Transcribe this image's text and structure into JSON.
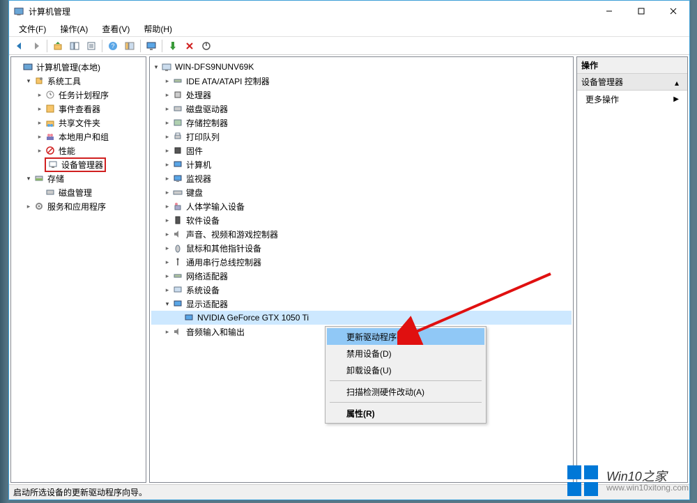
{
  "window": {
    "title": "计算机管理",
    "statusbar": "启动所选设备的更新驱动程序向导。"
  },
  "menubar": [
    {
      "label": "文件(F)"
    },
    {
      "label": "操作(A)"
    },
    {
      "label": "查看(V)"
    },
    {
      "label": "帮助(H)"
    }
  ],
  "left_tree": {
    "root": "计算机管理(本地)",
    "groups": [
      {
        "label": "系统工具",
        "children": [
          "任务计划程序",
          "事件查看器",
          "共享文件夹",
          "本地用户和组",
          "性能",
          "设备管理器"
        ]
      },
      {
        "label": "存储",
        "children": [
          "磁盘管理"
        ]
      },
      {
        "label": "服务和应用程序",
        "children": []
      }
    ]
  },
  "mid_tree": {
    "root": "WIN-DFS9NUNV69K",
    "categories": [
      "IDE ATA/ATAPI 控制器",
      "处理器",
      "磁盘驱动器",
      "存储控制器",
      "打印队列",
      "固件",
      "计算机",
      "监视器",
      "键盘",
      "人体学输入设备",
      "软件设备",
      "声音、视频和游戏控制器",
      "鼠标和其他指针设备",
      "通用串行总线控制器",
      "网络适配器",
      "系统设备",
      "显示适配器",
      "音频输入和输出"
    ],
    "display_adapter_item": "NVIDIA GeForce GTX 1050 Ti"
  },
  "right_panel": {
    "header": "操作",
    "section": "设备管理器",
    "item": "更多操作"
  },
  "context_menu": [
    "更新驱动程序(P)",
    "禁用设备(D)",
    "卸载设备(U)",
    "扫描检测硬件改动(A)",
    "属性(R)"
  ],
  "watermark": {
    "title": "Win10之家",
    "url": "www.win10xitong.com"
  },
  "icon_colors": {
    "folder": "#f7c56a",
    "accent": "#0078d7",
    "red": "#d02020"
  }
}
